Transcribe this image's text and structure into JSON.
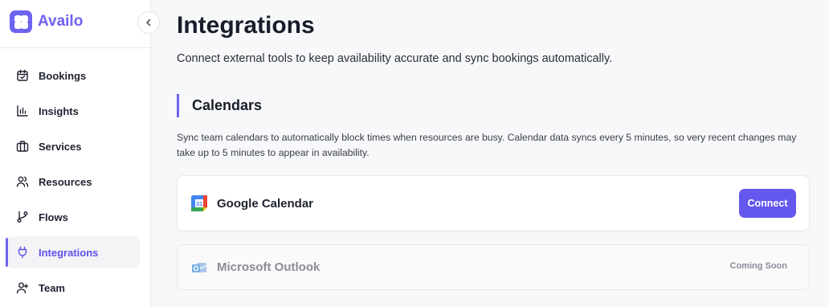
{
  "brand": {
    "name": "Availo",
    "accent": "#6e62f0"
  },
  "sidebar": {
    "items": [
      {
        "label": "Bookings",
        "icon": "calendar-icon",
        "active": false
      },
      {
        "label": "Insights",
        "icon": "bar-chart-icon",
        "active": false
      },
      {
        "label": "Services",
        "icon": "briefcase-icon",
        "active": false
      },
      {
        "label": "Resources",
        "icon": "users-icon",
        "active": false
      },
      {
        "label": "Flows",
        "icon": "git-branch-icon",
        "active": false
      },
      {
        "label": "Integrations",
        "icon": "plug-icon",
        "active": true
      },
      {
        "label": "Team",
        "icon": "user-plus-icon",
        "active": false
      }
    ]
  },
  "page": {
    "title": "Integrations",
    "subtitle": "Connect external tools to keep availability accurate and sync bookings automatically."
  },
  "calendars": {
    "heading": "Calendars",
    "description": "Sync team calendars to automatically block times when resources are busy. Calendar data syncs every 5 minutes, so very recent changes may take up to 5 minutes to appear in availability.",
    "providers": [
      {
        "name": "Google Calendar",
        "icon": "google-calendar-icon",
        "action": "Connect"
      },
      {
        "name": "Microsoft Outlook",
        "icon": "outlook-icon",
        "status": "Coming Soon"
      }
    ]
  }
}
